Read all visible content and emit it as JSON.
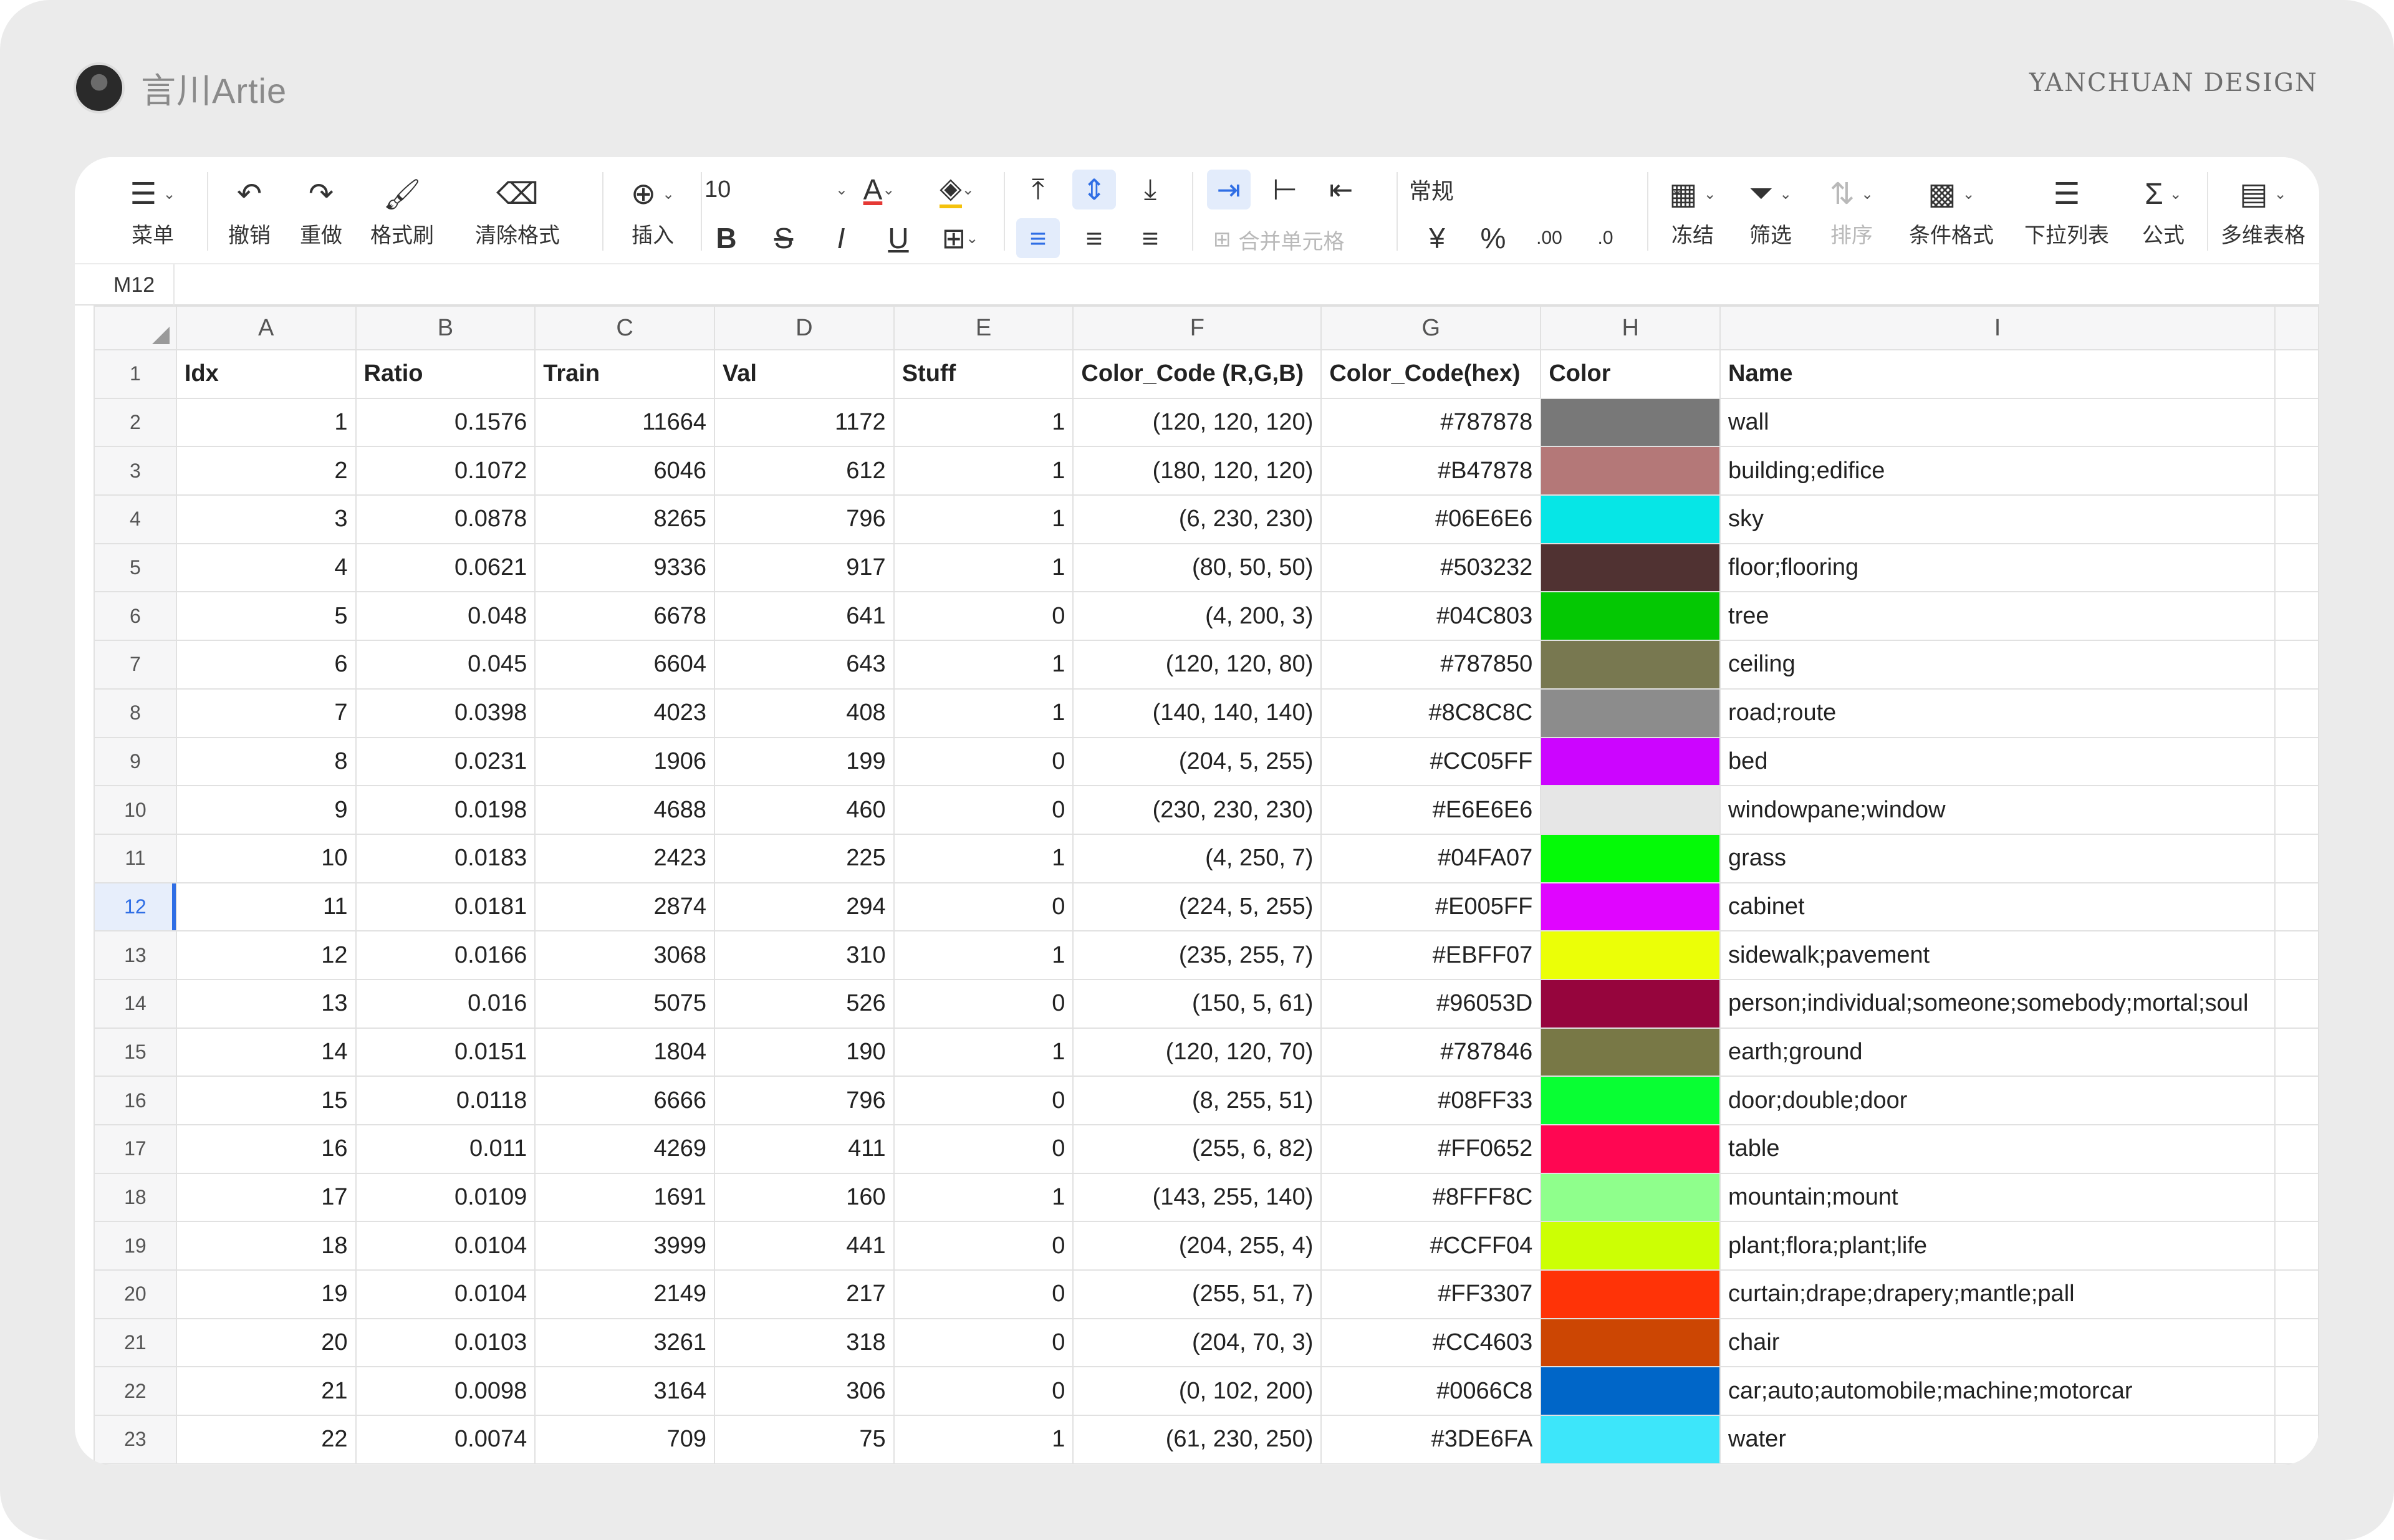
{
  "brand": {
    "name": "言川Artie",
    "design_mark": "YANCHUAN DESIGN"
  },
  "toolbar": {
    "menu": "菜单",
    "undo": "撤销",
    "redo": "重做",
    "format_painter": "格式刷",
    "clear_format": "清除格式",
    "insert": "插入",
    "font_size": "10",
    "number_format": "常规",
    "merge_cells": "合并单元格",
    "freeze": "冻结",
    "filter": "筛选",
    "sort": "排序",
    "conditional_format": "条件格式",
    "dropdown_list": "下拉列表",
    "formula": "公式",
    "multi_table": "多维表格",
    "bold": "B",
    "strike": "S",
    "italic": "I",
    "underline": "U",
    "currency": "¥",
    "percent": "%"
  },
  "namebar": {
    "cell_ref": "M12"
  },
  "columns": [
    "A",
    "B",
    "C",
    "D",
    "E",
    "F",
    "G",
    "H",
    "I"
  ],
  "header_row": [
    "Idx",
    "Ratio",
    "Train",
    "Val",
    "Stuff",
    "Color_Code (R,G,B)",
    "Color_Code(hex)",
    "Color",
    "Name"
  ],
  "rows": [
    {
      "idx": "1",
      "ratio": "0.1576",
      "train": "11664",
      "val": "1172",
      "stuff": "1",
      "rgb": "(120, 120, 120)",
      "hex": "#787878",
      "name": "wall"
    },
    {
      "idx": "2",
      "ratio": "0.1072",
      "train": "6046",
      "val": "612",
      "stuff": "1",
      "rgb": "(180, 120, 120)",
      "hex": "#B47878",
      "name": "building;edifice"
    },
    {
      "idx": "3",
      "ratio": "0.0878",
      "train": "8265",
      "val": "796",
      "stuff": "1",
      "rgb": "(6, 230, 230)",
      "hex": "#06E6E6",
      "name": "sky"
    },
    {
      "idx": "4",
      "ratio": "0.0621",
      "train": "9336",
      "val": "917",
      "stuff": "1",
      "rgb": "(80, 50, 50)",
      "hex": "#503232",
      "name": "floor;flooring"
    },
    {
      "idx": "5",
      "ratio": "0.048",
      "train": "6678",
      "val": "641",
      "stuff": "0",
      "rgb": "(4, 200, 3)",
      "hex": "#04C803",
      "name": "tree"
    },
    {
      "idx": "6",
      "ratio": "0.045",
      "train": "6604",
      "val": "643",
      "stuff": "1",
      "rgb": "(120, 120, 80)",
      "hex": "#787850",
      "name": "ceiling"
    },
    {
      "idx": "7",
      "ratio": "0.0398",
      "train": "4023",
      "val": "408",
      "stuff": "1",
      "rgb": "(140, 140, 140)",
      "hex": "#8C8C8C",
      "name": "road;route"
    },
    {
      "idx": "8",
      "ratio": "0.0231",
      "train": "1906",
      "val": "199",
      "stuff": "0",
      "rgb": "(204, 5, 255)",
      "hex": "#CC05FF",
      "name": "bed"
    },
    {
      "idx": "9",
      "ratio": "0.0198",
      "train": "4688",
      "val": "460",
      "stuff": "0",
      "rgb": "(230, 230, 230)",
      "hex": "#E6E6E6",
      "name": "windowpane;window"
    },
    {
      "idx": "10",
      "ratio": "0.0183",
      "train": "2423",
      "val": "225",
      "stuff": "1",
      "rgb": "(4, 250, 7)",
      "hex": "#04FA07",
      "name": "grass"
    },
    {
      "idx": "11",
      "ratio": "0.0181",
      "train": "2874",
      "val": "294",
      "stuff": "0",
      "rgb": "(224, 5, 255)",
      "hex": "#E005FF",
      "name": "cabinet"
    },
    {
      "idx": "12",
      "ratio": "0.0166",
      "train": "3068",
      "val": "310",
      "stuff": "1",
      "rgb": "(235, 255, 7)",
      "hex": "#EBFF07",
      "name": "sidewalk;pavement"
    },
    {
      "idx": "13",
      "ratio": "0.016",
      "train": "5075",
      "val": "526",
      "stuff": "0",
      "rgb": "(150, 5, 61)",
      "hex": "#96053D",
      "name": "person;individual;someone;somebody;mortal;soul"
    },
    {
      "idx": "14",
      "ratio": "0.0151",
      "train": "1804",
      "val": "190",
      "stuff": "1",
      "rgb": "(120, 120, 70)",
      "hex": "#787846",
      "name": "earth;ground"
    },
    {
      "idx": "15",
      "ratio": "0.0118",
      "train": "6666",
      "val": "796",
      "stuff": "0",
      "rgb": "(8, 255, 51)",
      "hex": "#08FF33",
      "name": "door;double;door"
    },
    {
      "idx": "16",
      "ratio": "0.011",
      "train": "4269",
      "val": "411",
      "stuff": "0",
      "rgb": "(255, 6, 82)",
      "hex": "#FF0652",
      "name": "table"
    },
    {
      "idx": "17",
      "ratio": "0.0109",
      "train": "1691",
      "val": "160",
      "stuff": "1",
      "rgb": "(143, 255, 140)",
      "hex": "#8FFF8C",
      "name": "mountain;mount"
    },
    {
      "idx": "18",
      "ratio": "0.0104",
      "train": "3999",
      "val": "441",
      "stuff": "0",
      "rgb": "(204, 255, 4)",
      "hex": "#CCFF04",
      "name": "plant;flora;plant;life"
    },
    {
      "idx": "19",
      "ratio": "0.0104",
      "train": "2149",
      "val": "217",
      "stuff": "0",
      "rgb": "(255, 51, 7)",
      "hex": "#FF3307",
      "name": "curtain;drape;drapery;mantle;pall"
    },
    {
      "idx": "20",
      "ratio": "0.0103",
      "train": "3261",
      "val": "318",
      "stuff": "0",
      "rgb": "(204, 70, 3)",
      "hex": "#CC4603",
      "name": "chair"
    },
    {
      "idx": "21",
      "ratio": "0.0098",
      "train": "3164",
      "val": "306",
      "stuff": "0",
      "rgb": "(0, 102, 200)",
      "hex": "#0066C8",
      "name": "car;auto;automobile;machine;motorcar"
    },
    {
      "idx": "22",
      "ratio": "0.0074",
      "train": "709",
      "val": "75",
      "stuff": "1",
      "rgb": "(61, 230, 250)",
      "hex": "#3DE6FA",
      "name": "water"
    }
  ],
  "selected_row": 12,
  "colors": {
    "accent": "#2f6ee5"
  }
}
